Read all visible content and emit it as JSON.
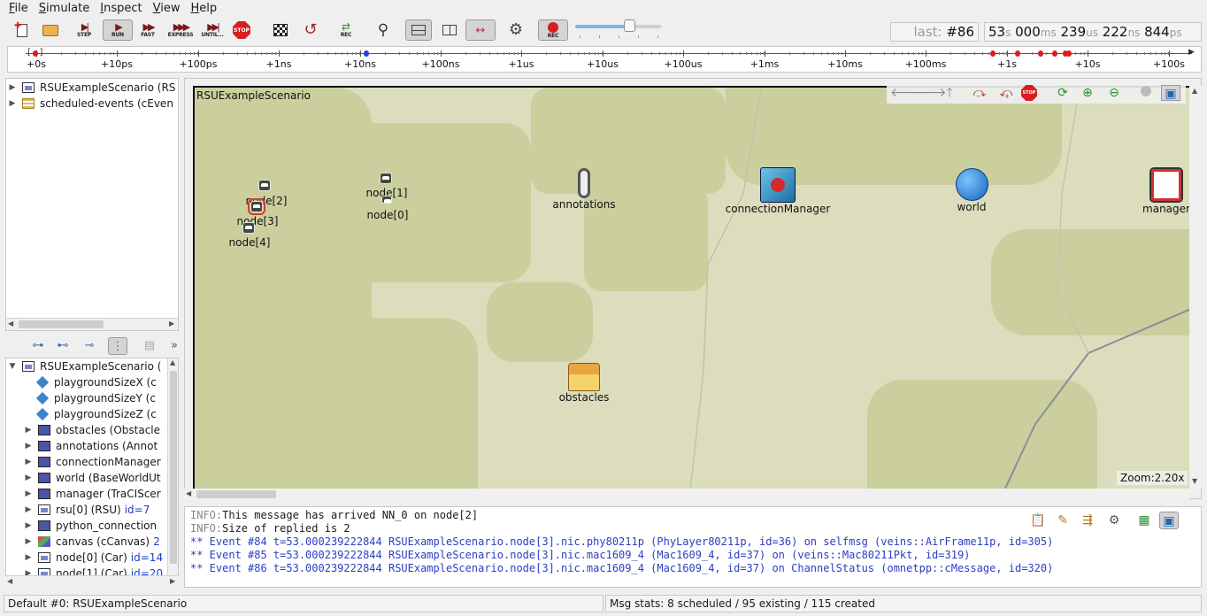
{
  "menu": [
    "File",
    "Simulate",
    "Inspect",
    "View",
    "Help"
  ],
  "toolbar": {
    "step": "STEP",
    "run": "RUN",
    "fast": "FAST",
    "express": "EXPRESS",
    "until": "UNTIL...",
    "stop": "STOP",
    "rec": "REC",
    "rec2": "REC",
    "slider_level": 0.6
  },
  "status_counter": {
    "last_label": "last:",
    "last_value": "#86"
  },
  "sim_time": {
    "s": "53",
    "s_u": "s",
    "ms": "000",
    "ms_u": "ms",
    "us": "239",
    "us_u": "us",
    "ns": "222",
    "ns_u": "ns",
    "ps": "844",
    "ps_u": "ps"
  },
  "timeline": {
    "labels": [
      "+0s",
      "+10ps",
      "+100ps",
      "+1ns",
      "+10ns",
      "+100ns",
      "+1us",
      "+10us",
      "+100us",
      "+1ms",
      "+10ms",
      "+100ms",
      "+1s",
      "+10s",
      "+100s"
    ],
    "event_colors": {
      "red": "#e01b1b",
      "blue": "#1d3fd8"
    }
  },
  "object_tree": [
    {
      "label": "RSUExampleScenario (RS",
      "icon": "module-icon"
    },
    {
      "label": "scheduled-events (cEven",
      "icon": "queue-icon"
    }
  ],
  "module_tree": {
    "root": "RSUExampleScenario (",
    "items": [
      {
        "label": "playgroundSizeX (c",
        "icon": "param-icon",
        "id": ""
      },
      {
        "label": "playgroundSizeY (c",
        "icon": "param-icon",
        "id": ""
      },
      {
        "label": "playgroundSizeZ (c",
        "icon": "param-icon",
        "id": ""
      },
      {
        "label": "obstacles (Obstacle",
        "icon": "module-icon",
        "id": ""
      },
      {
        "label": "annotations (Annot",
        "icon": "module-icon",
        "id": ""
      },
      {
        "label": "connectionManager",
        "icon": "module-icon",
        "id": ""
      },
      {
        "label": "world (BaseWorldUt",
        "icon": "module-icon",
        "id": ""
      },
      {
        "label": "manager (TraCIScer",
        "icon": "module-icon",
        "id": ""
      },
      {
        "label": "rsu[0] (RSU)",
        "icon": "compound-icon",
        "id": "id=7"
      },
      {
        "label": "python_connection",
        "icon": "module-icon",
        "id": ""
      },
      {
        "label": "canvas (cCanvas)",
        "icon": "canvas-icon",
        "id": "2"
      },
      {
        "label": "node[0] (Car)",
        "icon": "compound-icon",
        "id": "id=14"
      },
      {
        "label": "node[1] (Car)",
        "icon": "compound-icon",
        "id": "id=20"
      }
    ]
  },
  "canvas": {
    "title": "RSUExampleScenario",
    "zoom": "Zoom:2.20x",
    "nodes": {
      "node2": "node[2]",
      "node3": "node[3]",
      "node4": "node[4]",
      "node1": "node[1]",
      "node0": "node[0]",
      "annotations": "annotations",
      "connectionManager": "connectionManager",
      "world": "world",
      "manager": "manager",
      "obstacles": "obstacles"
    }
  },
  "log": [
    {
      "prefix": "INFO:",
      "text": "This message has arrived NN_0 on node[2]"
    },
    {
      "prefix": "INFO:",
      "text": "Size of replied is 2"
    },
    {
      "text": "** Event #84  t=53.000239222844  RSUExampleScenario.node[3].nic.phy80211p (PhyLayer80211p, id=36)  on selfmsg  (veins::AirFrame11p, id=305)"
    },
    {
      "text": "** Event #85  t=53.000239222844  RSUExampleScenario.node[3].nic.mac1609_4 (Mac1609_4, id=37)  on  (veins::Mac80211Pkt, id=319)"
    },
    {
      "text": "** Event #86  t=53.000239222844  RSUExampleScenario.node[3].nic.mac1609_4 (Mac1609_4, id=37)  on ChannelStatus (omnetpp::cMessage, id=320)"
    }
  ],
  "statusbar": {
    "left": "Default #0: RSUExampleScenario",
    "right": "Msg stats: 8 scheduled / 95 existing / 115 created"
  }
}
